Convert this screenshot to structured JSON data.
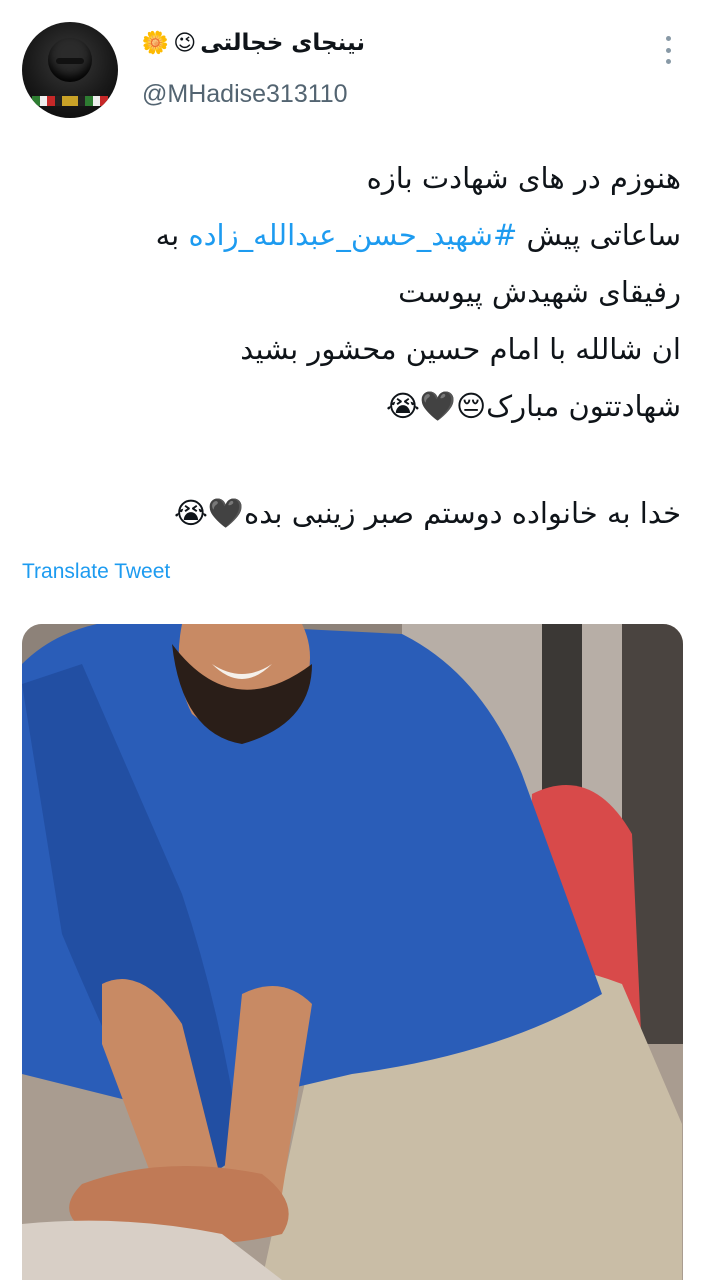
{
  "author": {
    "display_name": "نینجای خجالتی",
    "name_emojis": [
      "😉",
      "🌼"
    ],
    "handle": "@MHadise313110",
    "avatar_icon": "masked-figure-avatar"
  },
  "menu": {
    "icon": "more-vertical-icon"
  },
  "tweet": {
    "lines": [
      {
        "text": "هنوزم در های شهادت بازه"
      },
      {
        "before": "ساعاتی پیش ",
        "hashtag": "#شهید_حسن_عبدالله_زاده",
        "after": " به"
      },
      {
        "text": "رفیقای شهیدش پیوست"
      },
      {
        "text": "ان شالله با امام حسین محشور بشید"
      },
      {
        "text": "شهادتتون مبارک😔🖤😭"
      },
      {
        "text": "خدا به خانواده دوستم صبر زینبی بده🖤😭"
      }
    ],
    "translate_label": "Translate Tweet"
  },
  "media": {
    "icon": "photo-image",
    "colors": {
      "shirt": "#2a5db8",
      "pants": "#c9bda6",
      "skin": "#c88a64",
      "background": "#8d8279"
    }
  },
  "colors": {
    "accent": "#1d9bf0",
    "muted": "#536471",
    "text": "#0f1419"
  }
}
